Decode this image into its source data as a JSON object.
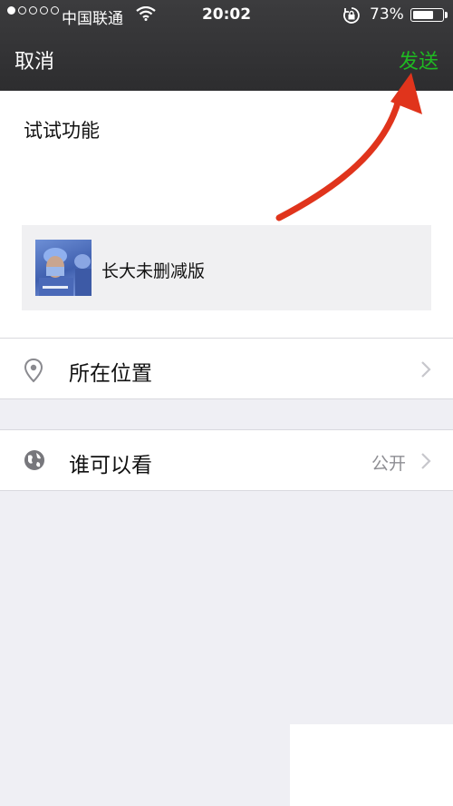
{
  "status_bar": {
    "carrier": "中国联通",
    "time": "20:02",
    "battery_percent": "73%",
    "battery_level": 0.73,
    "signal_bars_filled": 1,
    "signal_bars_total": 5
  },
  "nav": {
    "cancel_label": "取消",
    "send_label": "发送",
    "send_color": "#1fb922"
  },
  "compose": {
    "text": "试试功能",
    "shared_item_title": "长大未删减版"
  },
  "options": {
    "location_label": "所在位置",
    "visibility_label": "谁可以看",
    "visibility_value": "公开"
  },
  "icons": {
    "signal": "signal-dots-icon",
    "wifi": "wifi-icon",
    "orientation_lock": "orientation-lock-icon",
    "battery": "battery-icon",
    "location": "location-pin-icon",
    "globe": "globe-icon",
    "chevron": "chevron-right-icon",
    "annotation": "red-arrow-annotation"
  },
  "colors": {
    "nav_background": "#333335",
    "page_background": "#efeff4",
    "annotation_arrow": "#e0341c"
  }
}
